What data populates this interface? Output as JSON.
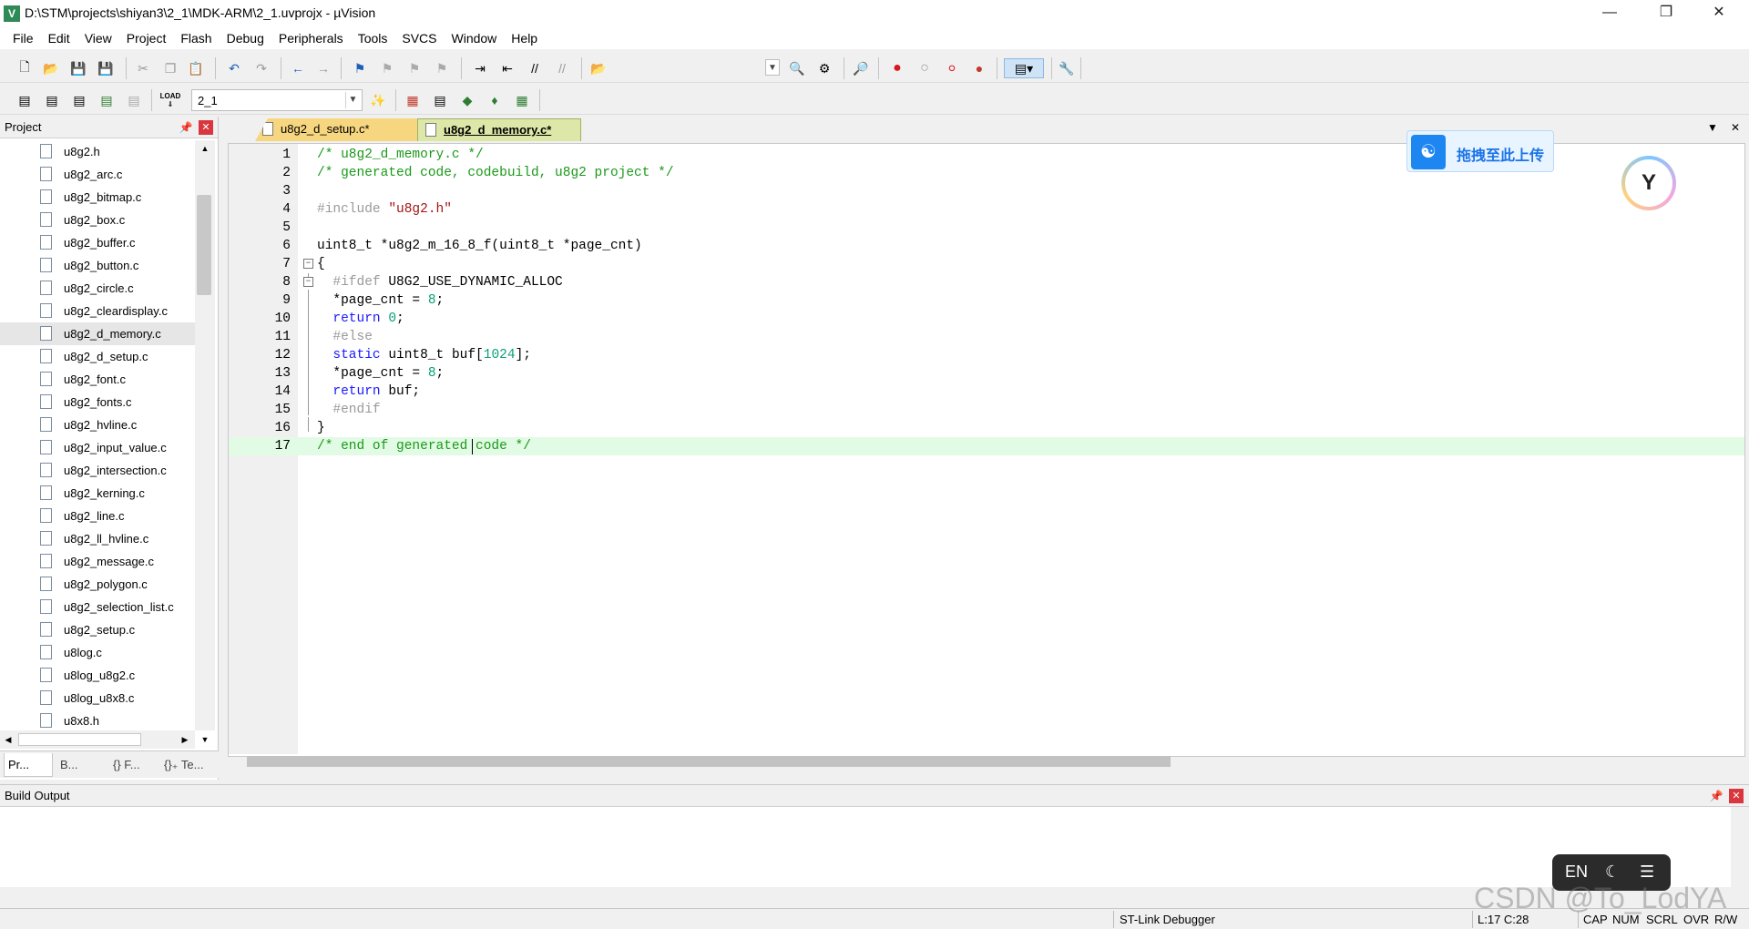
{
  "window": {
    "title": "D:\\STM\\projects\\shiyan3\\2_1\\MDK-ARM\\2_1.uvprojx - µVision",
    "app_icon": "V"
  },
  "menubar": [
    "File",
    "Edit",
    "View",
    "Project",
    "Flash",
    "Debug",
    "Peripherals",
    "Tools",
    "SVCS",
    "Window",
    "Help"
  ],
  "toolbar2": {
    "target": "2_1",
    "load_label": "LOAD"
  },
  "project_panel": {
    "title": "Project",
    "files": [
      "u8g2.h",
      "u8g2_arc.c",
      "u8g2_bitmap.c",
      "u8g2_box.c",
      "u8g2_buffer.c",
      "u8g2_button.c",
      "u8g2_circle.c",
      "u8g2_cleardisplay.c",
      "u8g2_d_memory.c",
      "u8g2_d_setup.c",
      "u8g2_font.c",
      "u8g2_fonts.c",
      "u8g2_hvline.c",
      "u8g2_input_value.c",
      "u8g2_intersection.c",
      "u8g2_kerning.c",
      "u8g2_line.c",
      "u8g2_ll_hvline.c",
      "u8g2_message.c",
      "u8g2_polygon.c",
      "u8g2_selection_list.c",
      "u8g2_setup.c",
      "u8log.c",
      "u8log_u8g2.c",
      "u8log_u8x8.c",
      "u8x8.h"
    ],
    "selected": "u8g2_d_memory.c",
    "tabs": [
      "Pr...",
      "B...",
      "{} F...",
      "{}₊ Te..."
    ]
  },
  "editor": {
    "tabs": [
      {
        "label": "u8g2_d_setup.c*",
        "active": false
      },
      {
        "label": "u8g2_d_memory.c*",
        "active": true
      }
    ],
    "line_numbers": [
      "1",
      "2",
      "3",
      "4",
      "5",
      "6",
      "7",
      "8",
      "9",
      "10",
      "11",
      "12",
      "13",
      "14",
      "15",
      "16",
      "17"
    ],
    "current_line": 17
  },
  "upload_widget": {
    "label": "拖拽至此上传"
  },
  "build_output": {
    "title": "Build Output"
  },
  "ime": {
    "lang": "EN"
  },
  "statusbar": {
    "debugger": "ST-Link Debugger",
    "position": "L:17 C:28",
    "cap": "CAP",
    "num": "NUM",
    "scrl": "SCRL",
    "ovr": "OVR",
    "rw": "R/W"
  },
  "watermark": "CSDN @To_LodYA"
}
